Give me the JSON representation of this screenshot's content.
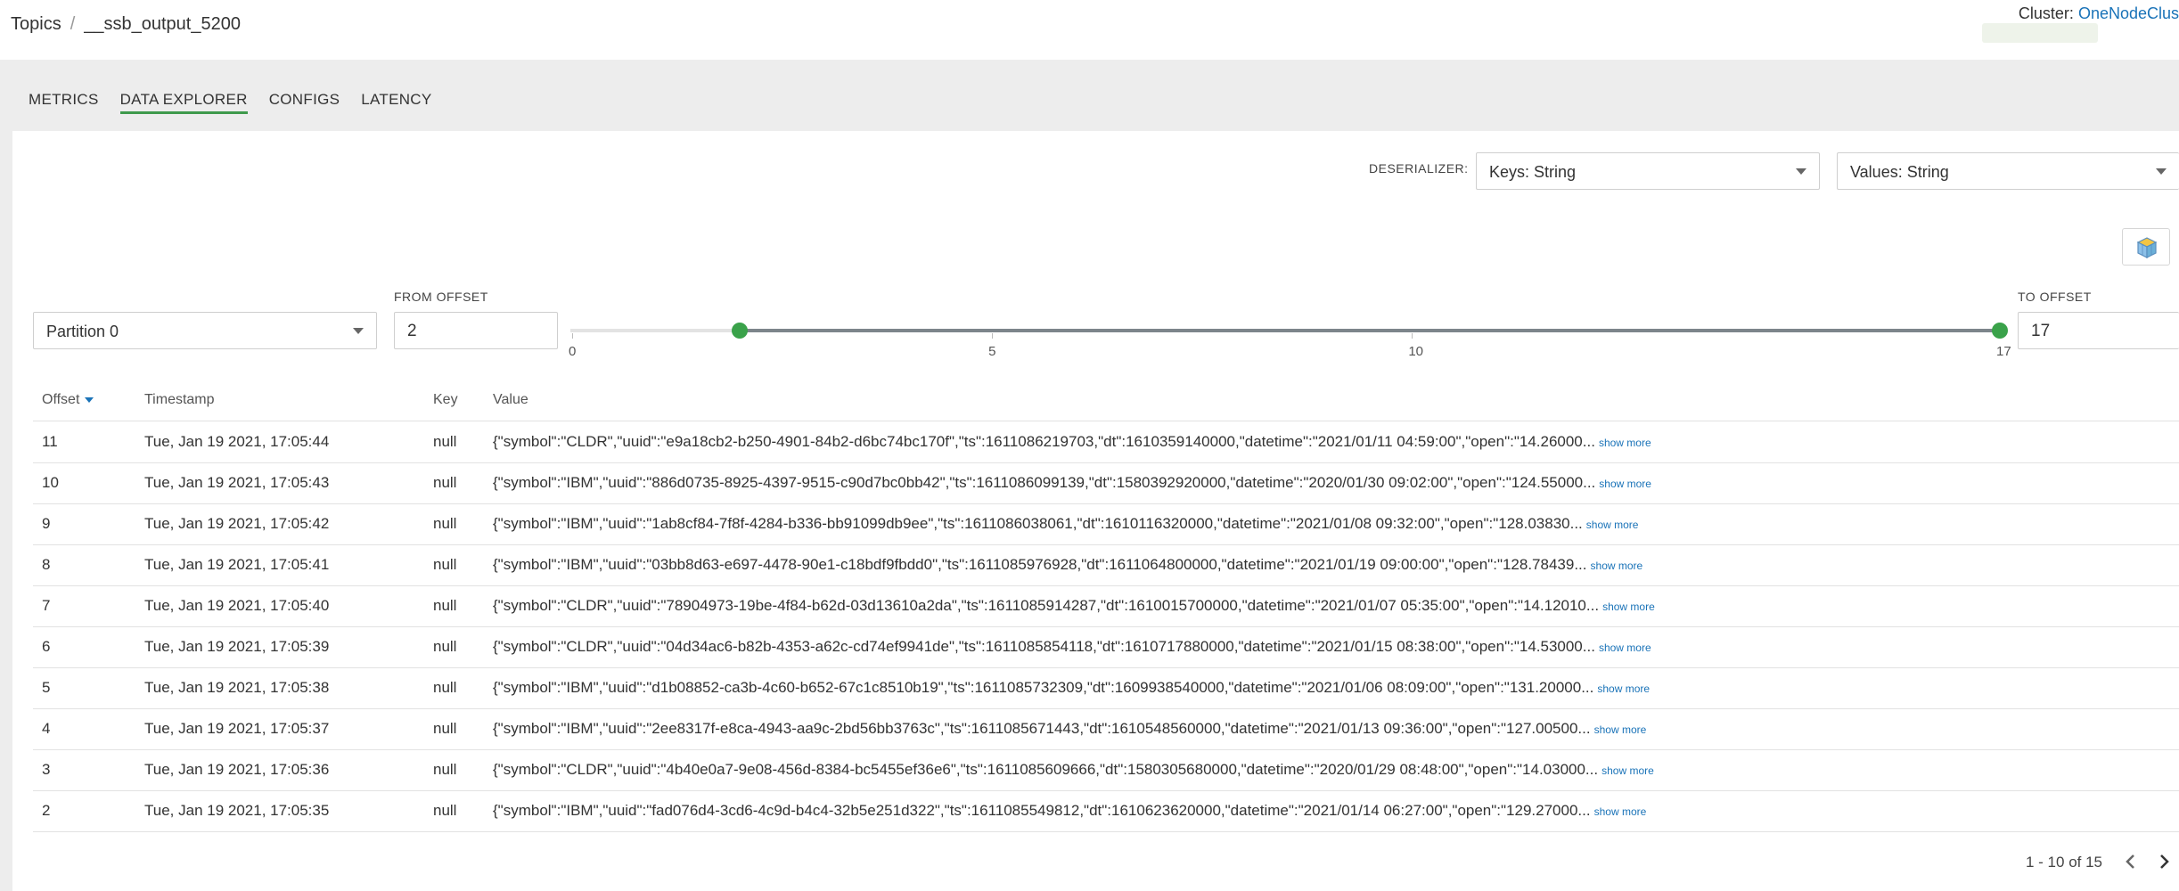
{
  "breadcrumb": {
    "root": "Topics",
    "separator": "/",
    "topic": "__ssb_output_5200"
  },
  "cluster": {
    "label": "Cluster:",
    "name": "OneNodeClus"
  },
  "tabs": [
    {
      "label": "METRICS",
      "active": false
    },
    {
      "label": "DATA EXPLORER",
      "active": true
    },
    {
      "label": "CONFIGS",
      "active": false
    },
    {
      "label": "LATENCY",
      "active": false
    }
  ],
  "deserializer": {
    "label": "DESERIALIZER:",
    "keys": "Keys: String",
    "values": "Values: String"
  },
  "toolbar": {
    "icon": "cube-icon"
  },
  "partition": {
    "value": "Partition 0"
  },
  "from_offset": {
    "label": "FROM OFFSET",
    "value": "2"
  },
  "to_offset": {
    "label": "TO OFFSET",
    "value": "17"
  },
  "slider": {
    "min": 0,
    "max": 17,
    "low": 2,
    "high": 17,
    "ticks": [
      {
        "value": 0,
        "label": "0"
      },
      {
        "value": 5,
        "label": "5"
      },
      {
        "value": 10,
        "label": "10"
      },
      {
        "value": 17,
        "label": "17"
      }
    ],
    "accent": "#3aa24a"
  },
  "table": {
    "headers": {
      "offset": "Offset",
      "timestamp": "Timestamp",
      "key": "Key",
      "value": "Value"
    },
    "show_more": "show more",
    "rows": [
      {
        "offset": "11",
        "timestamp": "Tue, Jan 19 2021, 17:05:44",
        "key": "null",
        "value": "{\"symbol\":\"CLDR\",\"uuid\":\"e9a18cb2-b250-4901-84b2-d6bc74bc170f\",\"ts\":1611086219703,\"dt\":1610359140000,\"datetime\":\"2021/01/11 04:59:00\",\"open\":\"14.26000..."
      },
      {
        "offset": "10",
        "timestamp": "Tue, Jan 19 2021, 17:05:43",
        "key": "null",
        "value": "{\"symbol\":\"IBM\",\"uuid\":\"886d0735-8925-4397-9515-c90d7bc0bb42\",\"ts\":1611086099139,\"dt\":1580392920000,\"datetime\":\"2020/01/30 09:02:00\",\"open\":\"124.55000..."
      },
      {
        "offset": "9",
        "timestamp": "Tue, Jan 19 2021, 17:05:42",
        "key": "null",
        "value": "{\"symbol\":\"IBM\",\"uuid\":\"1ab8cf84-7f8f-4284-b336-bb91099db9ee\",\"ts\":1611086038061,\"dt\":1610116320000,\"datetime\":\"2021/01/08 09:32:00\",\"open\":\"128.03830..."
      },
      {
        "offset": "8",
        "timestamp": "Tue, Jan 19 2021, 17:05:41",
        "key": "null",
        "value": "{\"symbol\":\"IBM\",\"uuid\":\"03bb8d63-e697-4478-90e1-c18bdf9fbdd0\",\"ts\":1611085976928,\"dt\":1611064800000,\"datetime\":\"2021/01/19 09:00:00\",\"open\":\"128.78439..."
      },
      {
        "offset": "7",
        "timestamp": "Tue, Jan 19 2021, 17:05:40",
        "key": "null",
        "value": "{\"symbol\":\"CLDR\",\"uuid\":\"78904973-19be-4f84-b62d-03d13610a2da\",\"ts\":1611085914287,\"dt\":1610015700000,\"datetime\":\"2021/01/07 05:35:00\",\"open\":\"14.12010..."
      },
      {
        "offset": "6",
        "timestamp": "Tue, Jan 19 2021, 17:05:39",
        "key": "null",
        "value": "{\"symbol\":\"CLDR\",\"uuid\":\"04d34ac6-b82b-4353-a62c-cd74ef9941de\",\"ts\":1611085854118,\"dt\":1610717880000,\"datetime\":\"2021/01/15 08:38:00\",\"open\":\"14.53000..."
      },
      {
        "offset": "5",
        "timestamp": "Tue, Jan 19 2021, 17:05:38",
        "key": "null",
        "value": "{\"symbol\":\"IBM\",\"uuid\":\"d1b08852-ca3b-4c60-b652-67c1c8510b19\",\"ts\":1611085732309,\"dt\":1609938540000,\"datetime\":\"2021/01/06 08:09:00\",\"open\":\"131.20000..."
      },
      {
        "offset": "4",
        "timestamp": "Tue, Jan 19 2021, 17:05:37",
        "key": "null",
        "value": "{\"symbol\":\"IBM\",\"uuid\":\"2ee8317f-e8ca-4943-aa9c-2bd56bb3763c\",\"ts\":1611085671443,\"dt\":1610548560000,\"datetime\":\"2021/01/13 09:36:00\",\"open\":\"127.00500..."
      },
      {
        "offset": "3",
        "timestamp": "Tue, Jan 19 2021, 17:05:36",
        "key": "null",
        "value": "{\"symbol\":\"CLDR\",\"uuid\":\"4b40e0a7-9e08-456d-8384-bc5455ef36e6\",\"ts\":1611085609666,\"dt\":1580305680000,\"datetime\":\"2020/01/29 08:48:00\",\"open\":\"14.03000..."
      },
      {
        "offset": "2",
        "timestamp": "Tue, Jan 19 2021, 17:05:35",
        "key": "null",
        "value": "{\"symbol\":\"IBM\",\"uuid\":\"fad076d4-3cd6-4c9d-b4c4-32b5e251d322\",\"ts\":1611085549812,\"dt\":1610623620000,\"datetime\":\"2021/01/14 06:27:00\",\"open\":\"129.27000..."
      }
    ]
  },
  "pagination": {
    "label": "1 - 10 of 15",
    "prev_icon": "chevron-left-icon",
    "next_icon": "chevron-right-icon"
  }
}
